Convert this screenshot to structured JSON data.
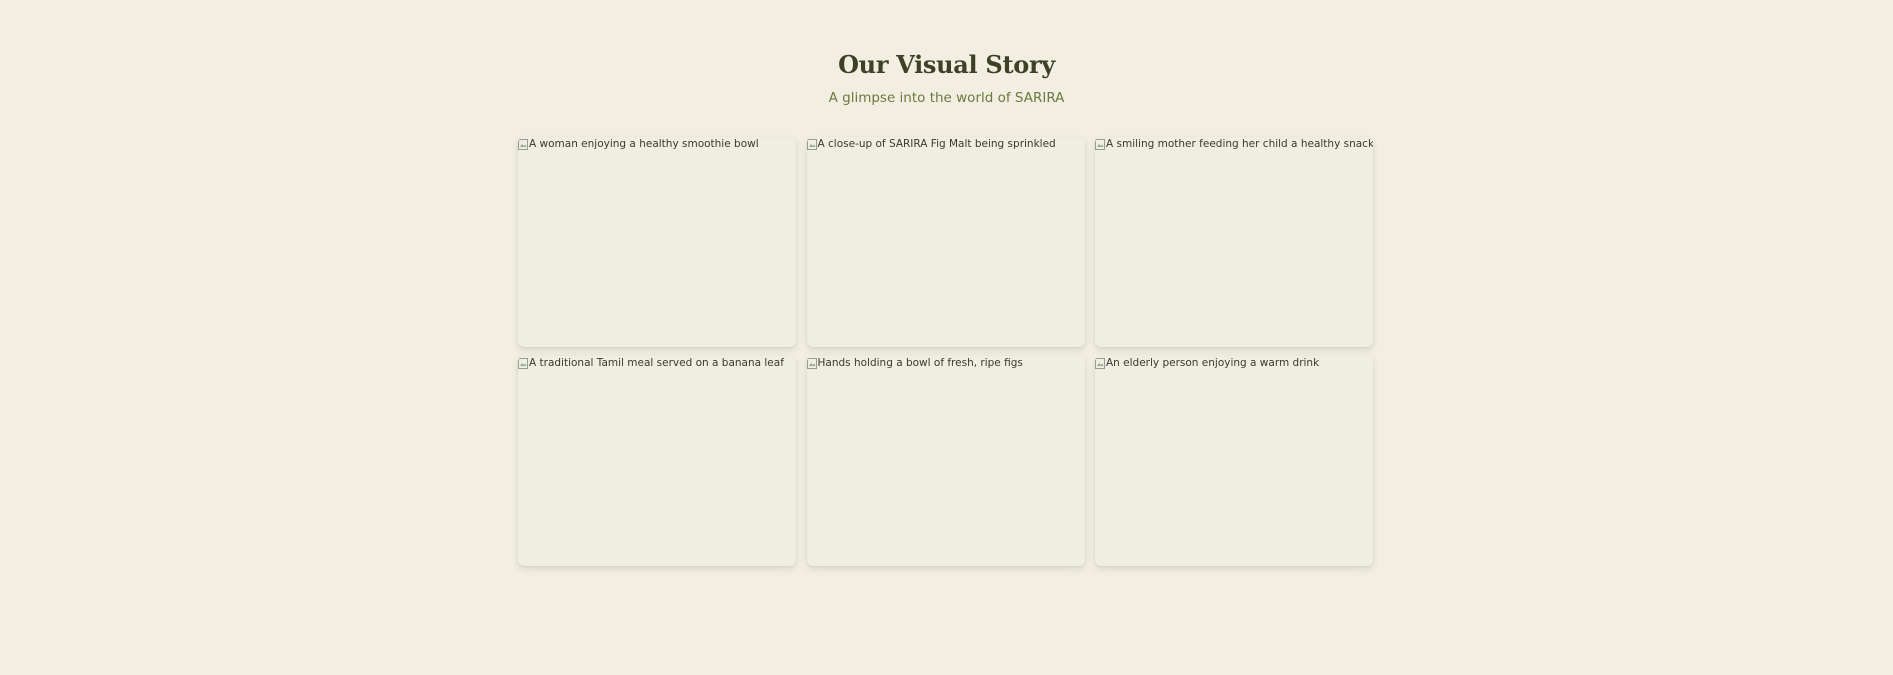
{
  "gallery": {
    "title": "Our Visual Story",
    "subtitle": "A glimpse into the world of SARIRA",
    "images": [
      {
        "alt": "A woman enjoying a healthy smoothie bowl",
        "icon": "broken-image-icon"
      },
      {
        "alt": "A close-up of SARIRA Fig Malt being sprinkled",
        "icon": "broken-image-icon"
      },
      {
        "alt": "A smiling mother feeding her child a healthy snack",
        "icon": "broken-image-icon"
      },
      {
        "alt": "A traditional Tamil meal served on a banana leaf",
        "icon": "broken-image-icon"
      },
      {
        "alt": "Hands holding a bowl of fresh, ripe figs",
        "icon": "broken-image-icon"
      },
      {
        "alt": "An elderly person enjoying a warm drink",
        "icon": "broken-image-icon"
      }
    ]
  },
  "colors": {
    "background": "#f2efe2",
    "heading": "#3d4126",
    "subheading": "#6b7a3e",
    "card": "#f0ede1"
  }
}
